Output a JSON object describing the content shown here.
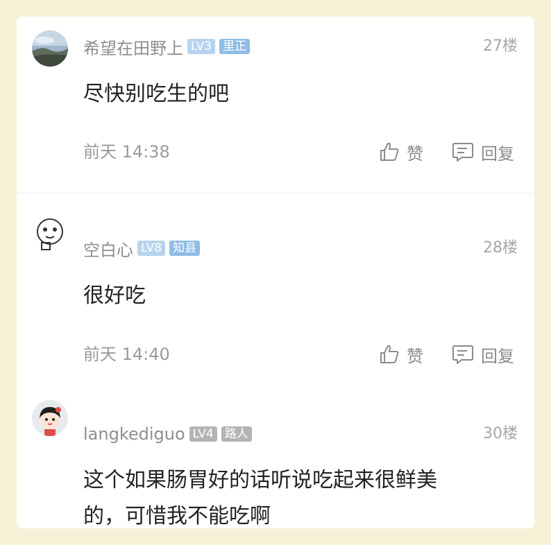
{
  "theme": {
    "background": "#f6f2d8",
    "card": "#ffffff",
    "level_badge": "#b6d4ee",
    "title_badge": "#8fbde6",
    "title_badge_gray": "#b4b4b4"
  },
  "comments": [
    {
      "avatar": "landscape-photo-avatar",
      "username": "希望在田野上",
      "level": "LV3",
      "title": "里正",
      "floor": "27楼",
      "content": "尽快别吃生的吧",
      "time": "前天 14:38",
      "like_label": "赞",
      "reply_label": "回复"
    },
    {
      "avatar": "cartoon-face-avatar",
      "username": "空白心",
      "level": "LV8",
      "title": "知县",
      "floor": "28楼",
      "content": "很好吃",
      "time": "前天 14:40",
      "like_label": "赞",
      "reply_label": "回复"
    },
    {
      "avatar": "cartoon-girl-avatar",
      "username": "langkediguo",
      "level": "LV4",
      "title": "路人",
      "floor": "30楼",
      "content_line1": "这个如果肠胃好的话听说吃起来很鲜美",
      "content_line2": "的，可惜我不能吃啊"
    }
  ]
}
